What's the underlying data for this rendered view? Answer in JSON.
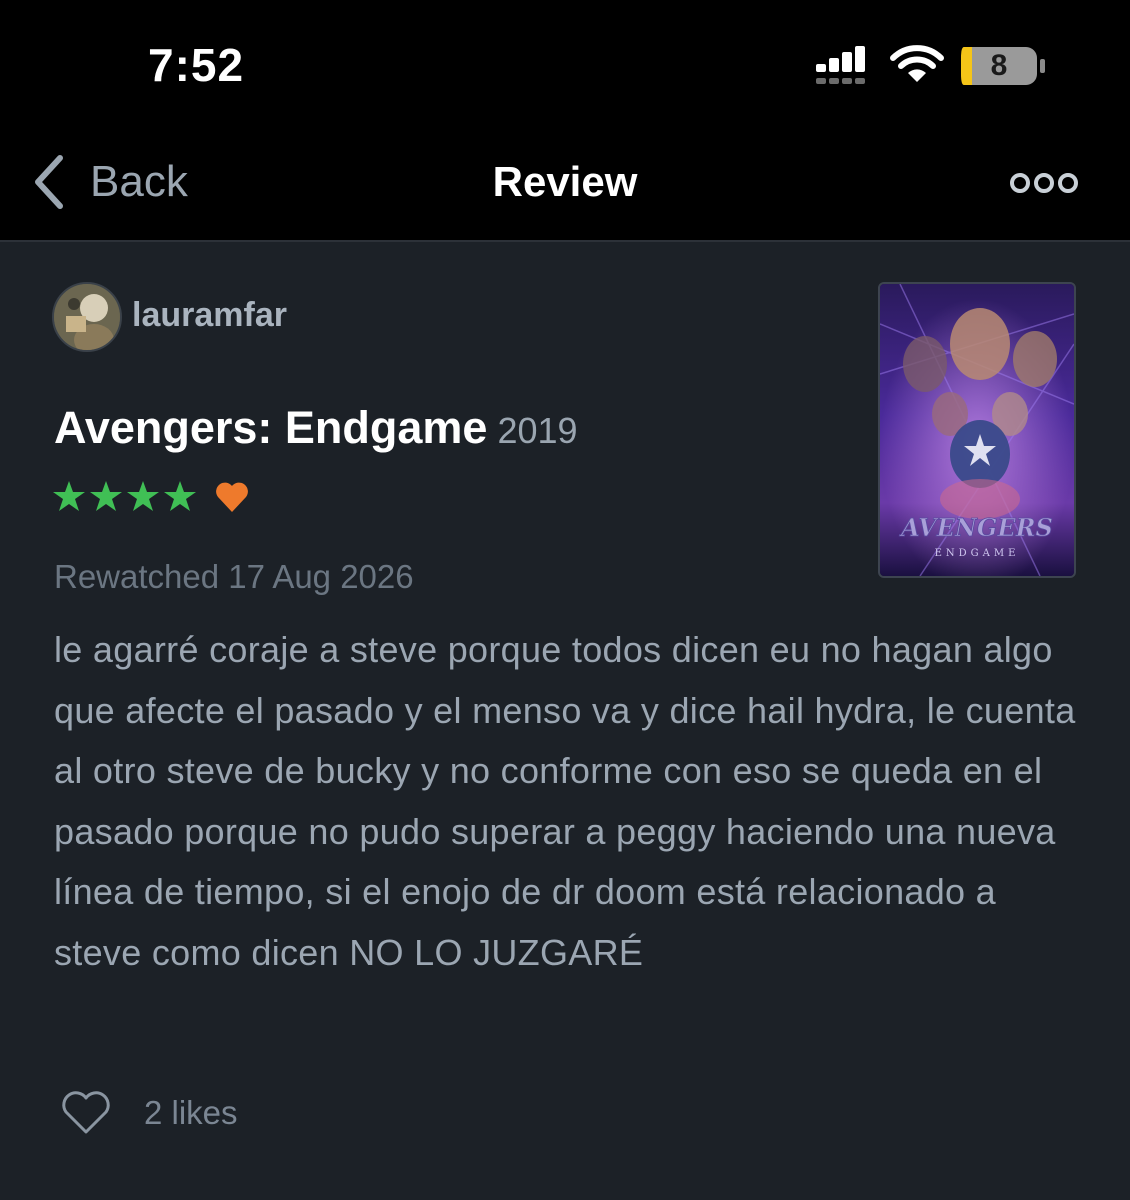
{
  "status_bar": {
    "time": "7:52",
    "battery_level": "8",
    "icons": [
      "signal-icon",
      "wifi-icon",
      "battery-icon"
    ]
  },
  "nav": {
    "back_label": "Back",
    "title": "Review",
    "icons": [
      "chevron-left-icon",
      "more-icon"
    ]
  },
  "review": {
    "username": "lauramfar",
    "film_title": "Avengers: Endgame",
    "film_year": "2019",
    "rating_stars": 4,
    "liked": true,
    "watched_line": "Rewatched 17 Aug 2026",
    "text": "le agarré coraje a steve porque todos dicen eu no hagan algo que afecte el pasado y el menso va y dice hail hydra, le cuenta al otro steve de bucky y no conforme con eso se queda en el pasado porque no pudo superar a peggy haciendo una nueva línea de tiempo, si el enojo de dr doom está relacionado a steve como dicen NO LO JUZGARÉ",
    "likes_label": "2 likes",
    "poster_title": "AVENGERS",
    "poster_subtitle": "ENDGAME"
  },
  "colors": {
    "background": "#000000",
    "card": "#1c2127",
    "star": "#40bf55",
    "heart": "#ee7a2c",
    "muted_text": "#9ba6b2"
  }
}
